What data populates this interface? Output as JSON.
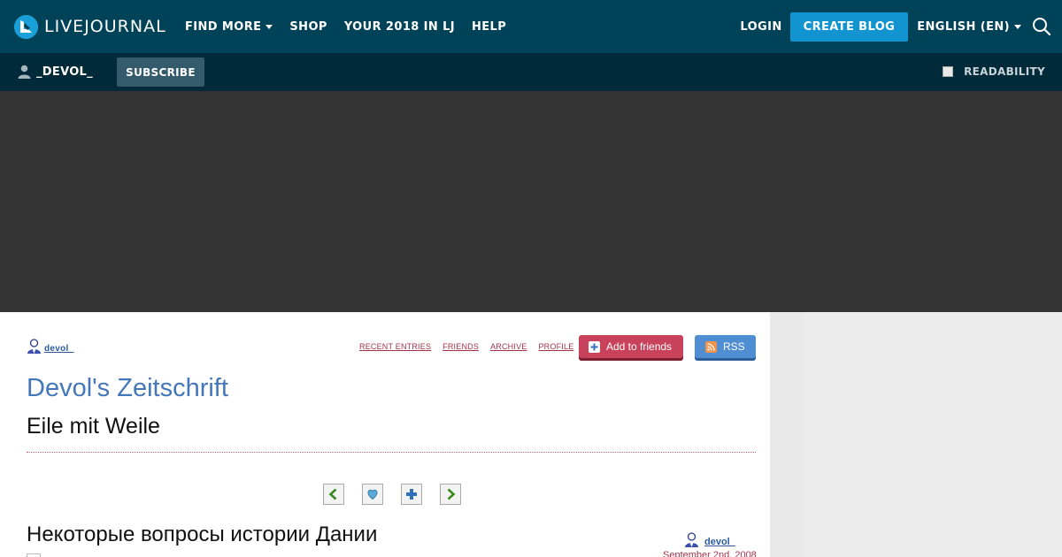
{
  "topbar": {
    "logo_text": "LIVEJOURNAL",
    "nav": [
      {
        "label": "FIND MORE",
        "dropdown": true
      },
      {
        "label": "SHOP",
        "dropdown": false
      },
      {
        "label": "YOUR 2018 IN LJ",
        "dropdown": false
      },
      {
        "label": "HELP",
        "dropdown": false
      }
    ],
    "login_label": "LOGIN",
    "create_blog_label": "CREATE BLOG",
    "language_label": "ENGLISH (EN)"
  },
  "journalbar": {
    "username": "_DEVOL_",
    "subscribe_label": "SUBSCRIBE",
    "readability_label": "READABILITY"
  },
  "journal": {
    "username": "devol_",
    "links": [
      "RECENT ENTRIES",
      "FRIENDS",
      "ARCHIVE",
      "PROFILE"
    ],
    "add_friends_label": "Add to friends",
    "rss_label": "RSS",
    "title": "Devol's Zeitschrift",
    "subtitle": "Eile mit Weile"
  },
  "post": {
    "title": "Некоторые вопросы истории Дании",
    "author": "devol_",
    "date": "September 2nd, 2008"
  },
  "colors": {
    "topbar": "#004359",
    "journalbar": "#00293a",
    "accent": "#1294d0",
    "link": "#a3344b",
    "title": "#4477b9"
  }
}
